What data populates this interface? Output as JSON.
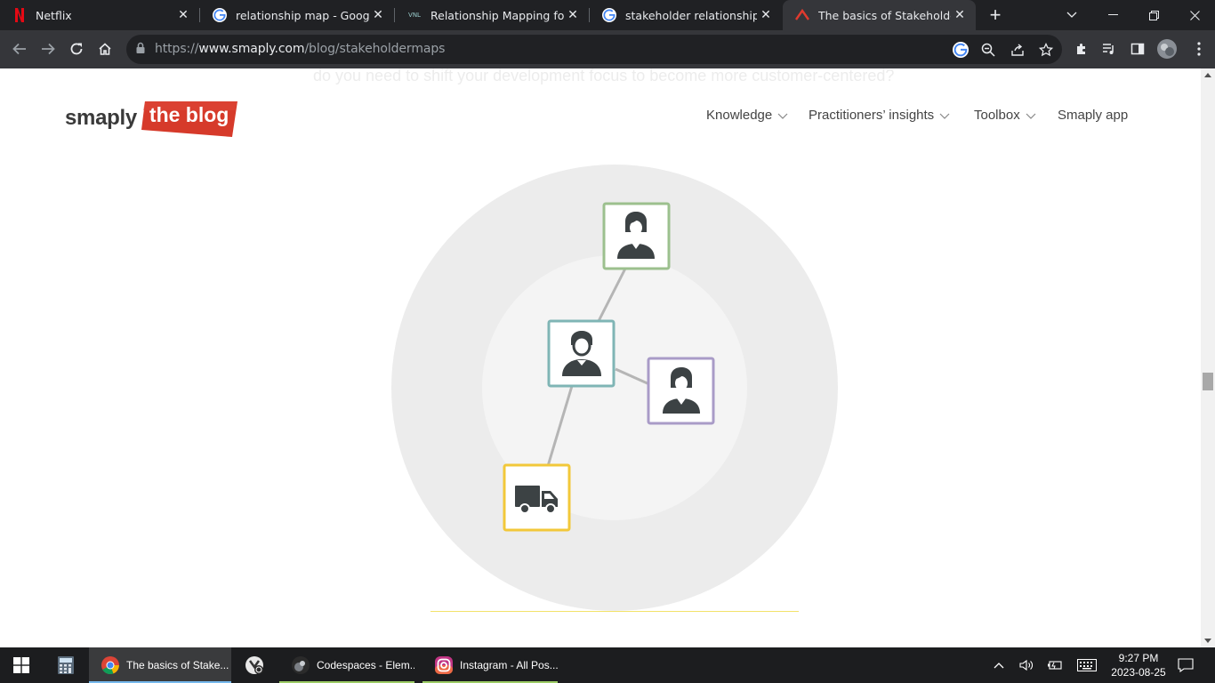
{
  "browser": {
    "tabs": [
      {
        "title": "Netflix",
        "favicon": "netflix-icon",
        "active": false
      },
      {
        "title": "relationship map - Google Se",
        "favicon": "google-icon",
        "active": false
      },
      {
        "title": "Relationship Mapping for Pul",
        "favicon": "vnl-icon",
        "active": false
      },
      {
        "title": "stakeholder relationship map",
        "favicon": "google-icon",
        "active": false
      },
      {
        "title": "The basics of Stakeholder Ma",
        "favicon": "smaply-icon",
        "active": true
      }
    ],
    "vnl_favicon_text": "VNL",
    "close_glyph": "✕",
    "new_tab_glyph": "+",
    "url_prefix": "https://",
    "url_host": "www.smaply.com",
    "url_path": "/blog/stakeholdermaps"
  },
  "page": {
    "ghost_text": "do you need to shift your development focus to become more customer-centered?",
    "logo_text": "smaply",
    "logo_badge": "the blog",
    "nav": [
      {
        "label": "Knowledge",
        "has_dropdown": true
      },
      {
        "label": "Practitioners’ insights",
        "has_dropdown": true
      },
      {
        "label": "Toolbox",
        "has_dropdown": true
      },
      {
        "label": "Smaply app",
        "has_dropdown": false
      }
    ],
    "diagram": {
      "outer_ring_color": "#ececec",
      "inner_ring_color": "#f4f4f4",
      "stakeholders": [
        {
          "name": "woman-outer",
          "icon": "woman-icon",
          "border": "#9cc08e"
        },
        {
          "name": "man-center",
          "icon": "man-icon",
          "border": "#7fb5b5"
        },
        {
          "name": "woman-right",
          "icon": "woman-icon",
          "border": "#a99bc7"
        },
        {
          "name": "delivery-truck",
          "icon": "truck-icon",
          "border": "#f2c83a"
        }
      ]
    }
  },
  "taskbar": {
    "items": [
      {
        "label": "",
        "icon": "calculator-icon"
      },
      {
        "label": "The basics of Stake...",
        "icon": "chrome-icon",
        "active": true
      },
      {
        "label": "",
        "icon": "app-icon"
      },
      {
        "label": "Codespaces - Elem...",
        "icon": "chrome-profile-icon"
      },
      {
        "label": "Instagram - All Pos...",
        "icon": "instagram-icon"
      }
    ],
    "time": "9:27 PM",
    "date": "2023-08-25"
  }
}
